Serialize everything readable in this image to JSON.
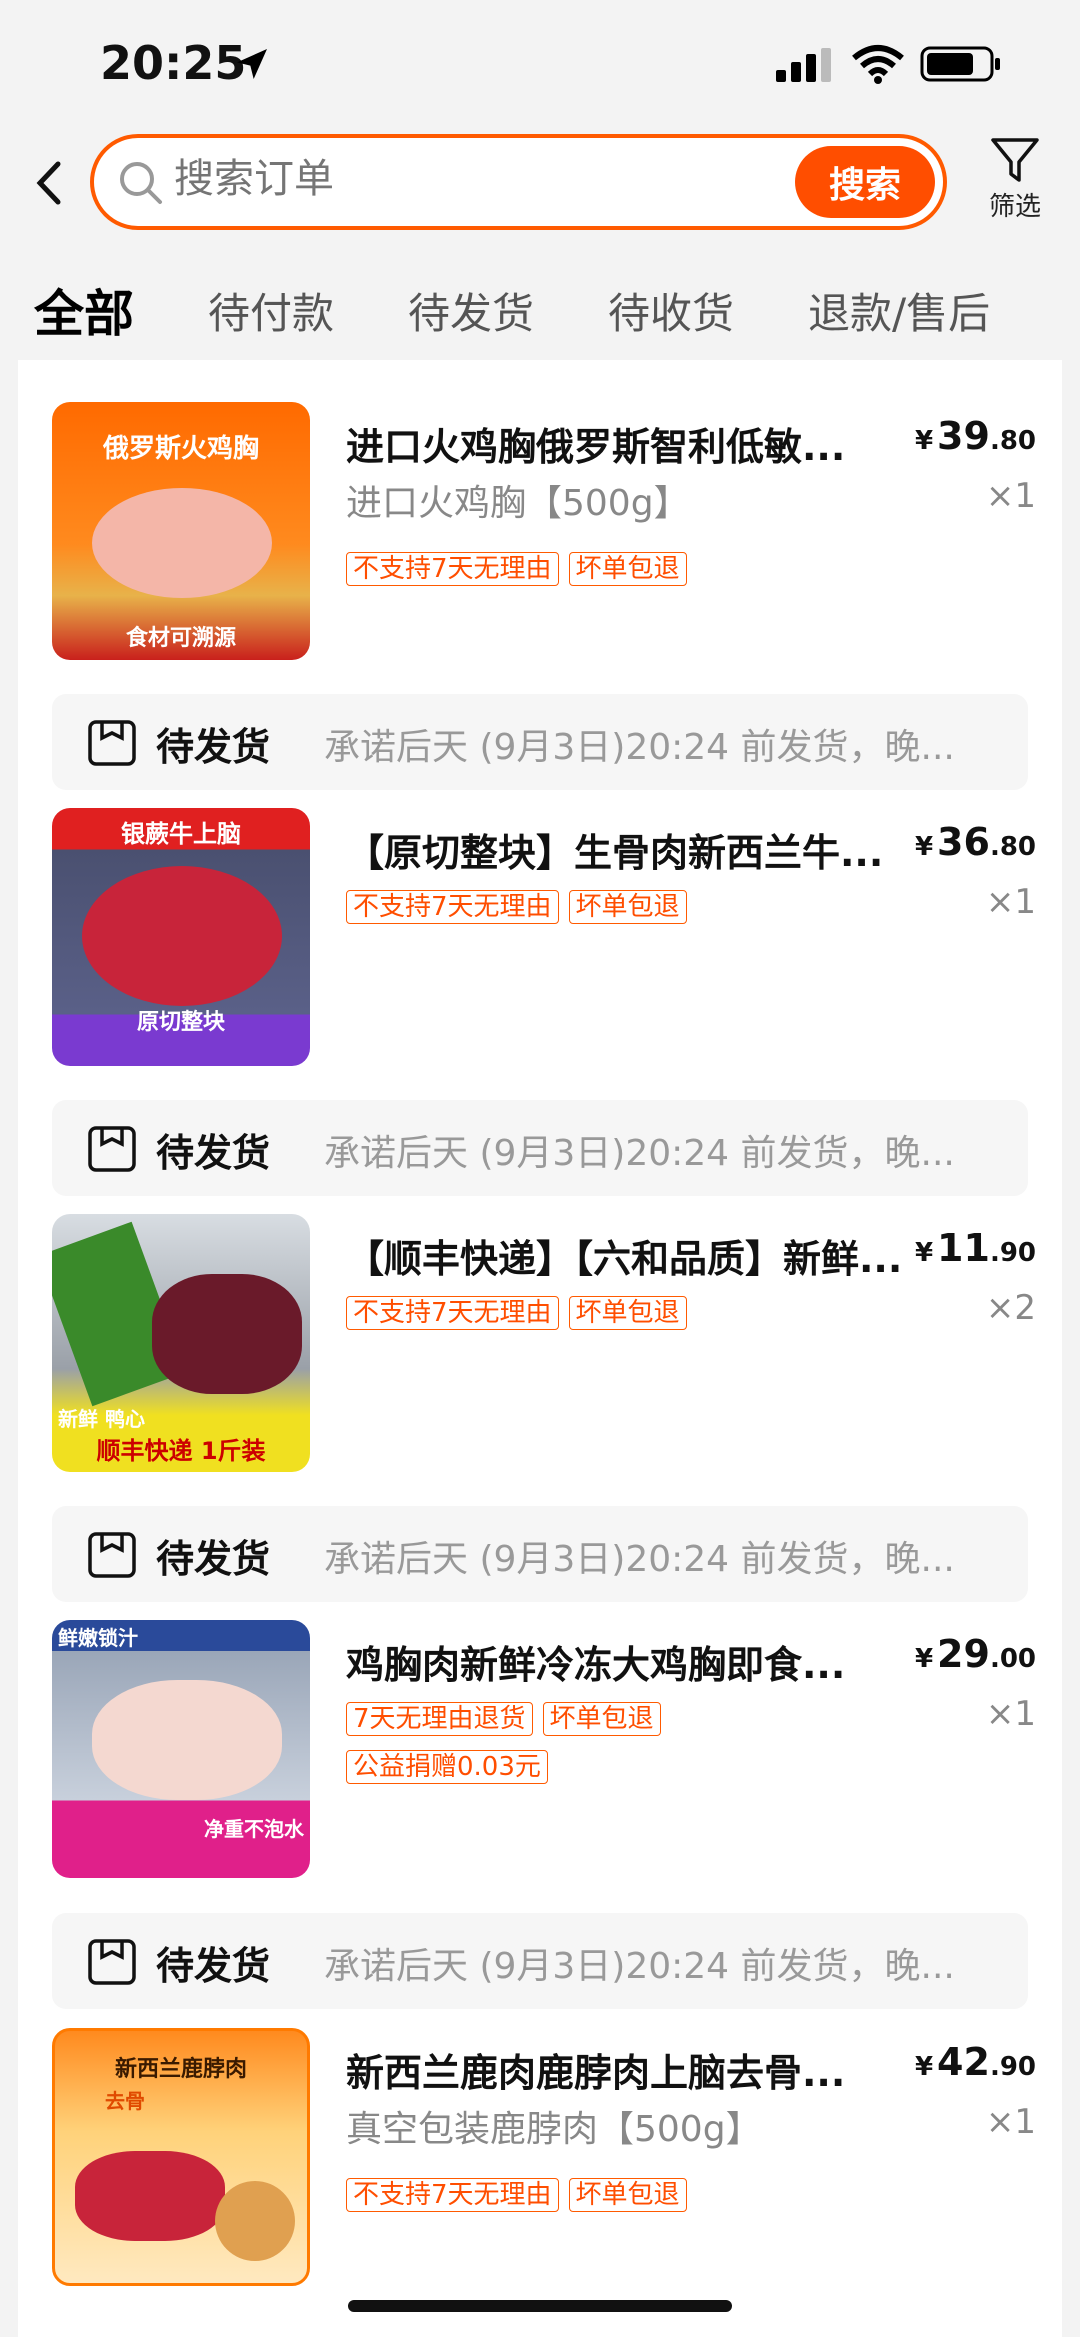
{
  "status_bar": {
    "time": "20:25"
  },
  "search": {
    "placeholder": "搜索订单",
    "button_label": "搜索",
    "filter_label": "筛选"
  },
  "tabs": [
    "全部",
    "待付款",
    "待发货",
    "待收货",
    "退款/售后"
  ],
  "items": [
    {
      "title": "进口火鸡胸俄罗斯智利低敏...",
      "spec": "进口火鸡胸【500g】",
      "price_int": "39",
      "price_dec": ".80",
      "qty": "×1",
      "tags": [
        "不支持7天无理由",
        "坏单包退"
      ],
      "thumb_text": "俄罗斯火鸡胸",
      "thumb_sub": "食材可溯源"
    },
    {
      "title": "【原切整块】生骨肉新西兰牛...",
      "spec": "",
      "price_int": "36",
      "price_dec": ".80",
      "qty": "×1",
      "tags": [
        "不支持7天无理由",
        "坏单包退"
      ],
      "thumb_text": "银蕨牛上脑",
      "thumb_sub": "原切整块"
    },
    {
      "title": "【顺丰快递】【六和品质】新鲜...",
      "spec": "",
      "price_int": "11",
      "price_dec": ".90",
      "qty": "×2",
      "tags": [
        "不支持7天无理由",
        "坏单包退"
      ],
      "thumb_text": "新鲜 鸭心",
      "thumb_sub": "顺丰快递 1斤装"
    },
    {
      "title": "鸡胸肉新鲜冷冻大鸡胸即食...",
      "spec": "",
      "price_int": "29",
      "price_dec": ".00",
      "qty": "×1",
      "tags": [
        "7天无理由退货",
        "坏单包退",
        "公益捐赠0.03元"
      ],
      "thumb_text": "鲜嫩锁汁",
      "thumb_sub": "净重不泡水"
    },
    {
      "title": "新西兰鹿肉鹿脖肉上脑去骨...",
      "spec": "真空包装鹿脖肉【500g】",
      "price_int": "42",
      "price_dec": ".90",
      "qty": "×1",
      "tags": [
        "不支持7天无理由",
        "坏单包退"
      ],
      "thumb_text": "新西兰鹿脖肉",
      "thumb_sub": "去骨"
    }
  ],
  "shipping": {
    "status": "待发货",
    "note": "承诺后天 (9月3日)20:24 前发货，晚..."
  }
}
